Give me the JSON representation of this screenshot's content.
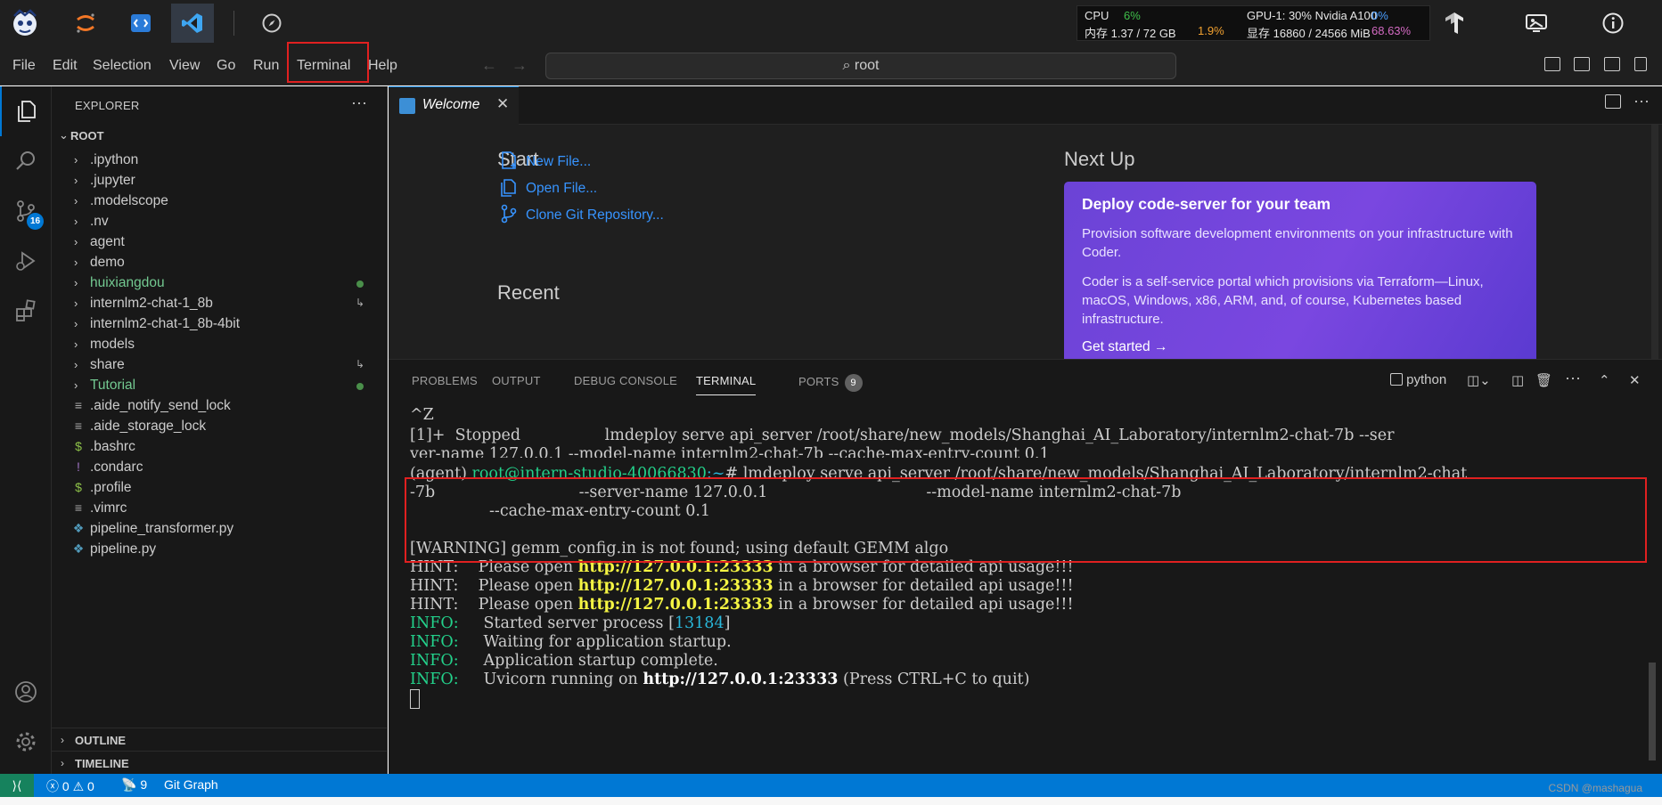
{
  "studio": {
    "stats": {
      "cpu_label": "CPU",
      "cpu_value": "6%",
      "mem_label": "内存 1.37 / 72 GB",
      "mem_value": "1.9%",
      "gpu_label": "GPU-1: 30% Nvidia A100",
      "gpu_value": "0%",
      "vram_label": "显存 16860 / 24566 MiB",
      "vram_value": "68.63%"
    }
  },
  "menubar": {
    "items": [
      "File",
      "Edit",
      "Selection",
      "View",
      "Go",
      "Run",
      "Terminal",
      "Help"
    ],
    "command_center": "root"
  },
  "activity": {
    "source_control_badge": "16"
  },
  "sidebar": {
    "title": "EXPLORER",
    "more": "···",
    "root": "ROOT",
    "items": [
      {
        "label": ".ipython",
        "type": "folder"
      },
      {
        "label": ".jupyter",
        "type": "folder"
      },
      {
        "label": ".modelscope",
        "type": "folder"
      },
      {
        "label": ".nv",
        "type": "folder"
      },
      {
        "label": "agent",
        "type": "folder"
      },
      {
        "label": "demo",
        "type": "folder"
      },
      {
        "label": "huixiangdou",
        "type": "folder"
      },
      {
        "label": "internlm2-chat-1_8b",
        "type": "folder"
      },
      {
        "label": "internlm2-chat-1_8b-4bit",
        "type": "folder"
      },
      {
        "label": "models",
        "type": "folder"
      },
      {
        "label": "share",
        "type": "folder"
      },
      {
        "label": "Tutorial",
        "type": "folder"
      },
      {
        "label": ".aide_notify_send_lock",
        "type": "file"
      },
      {
        "label": ".aide_storage_lock",
        "type": "file"
      },
      {
        "label": ".bashrc",
        "type": "file"
      },
      {
        "label": ".condarc",
        "type": "file"
      },
      {
        "label": ".profile",
        "type": "file"
      },
      {
        "label": ".vimrc",
        "type": "file"
      },
      {
        "label": "pipeline_transformer.py",
        "type": "file"
      },
      {
        "label": "pipeline.py",
        "type": "file"
      }
    ],
    "outline": "OUTLINE",
    "timeline": "TIMELINE"
  },
  "editor": {
    "tab_label": "Welcome",
    "start_heading": "Start",
    "new_file": "New File...",
    "open_file": "Open File...",
    "clone_repo": "Clone Git Repository...",
    "recent_heading": "Recent",
    "next_up_heading": "Next Up",
    "card": {
      "title": "Deploy code-server for your team",
      "p1": "Provision software development environments on your infrastructure with Coder.",
      "p2": "Coder is a self-service portal which provisions via Terraform—Linux, macOS, Windows, x86, ARM, and, of course, Kubernetes based infrastructure.",
      "link": "Get started →"
    }
  },
  "panel": {
    "tabs": [
      "PROBLEMS",
      "OUTPUT",
      "DEBUG CONSOLE",
      "TERMINAL",
      "PORTS"
    ],
    "ports_badge": "9",
    "shell": "python"
  },
  "terminal": {
    "l0": "^Z",
    "l1": "[1]+  Stopped                 lmdeploy serve api_server /root/share/new_models/Shanghai_AI_Laboratory/internlm2-chat-7b --ser",
    "l2": "ver-name 127.0.0.1 --model-name internlm2-chat-7b --cache-max-entry-count 0.1",
    "prompt_env": "(agent) ",
    "prompt_user": "root@intern-studio-40066830",
    "prompt_path": ":~",
    "cmd": "# lmdeploy serve api_server /root/share/new_models/Shanghai_AI_Laboratory/internlm2-chat",
    "cmd2": "-7b                             --server-name 127.0.0.1                                --model-name internlm2-chat-7b",
    "cmd3": "                --cache-max-entry-count 0.1",
    "warn": "[WARNING] gemm_config.in is not found; using default GEMM algo",
    "hint_pre": "HINT:    Please open ",
    "hint_url": "http://127.0.0.1:23333",
    "hint_post": " in a browser for detailed api usage!!!",
    "info_label": "INFO:",
    "info1_text": "     Started server process [",
    "info1_pid": "13184",
    "info1_end": "]",
    "info2_text": "     Waiting for application startup.",
    "info3_text": "     Application startup complete.",
    "info4_text": "     Uvicorn running on ",
    "info4_url": "http://127.0.0.1:23333",
    "info4_end": " (Press CTRL+C to quit)"
  },
  "statusbar": {
    "errors": "0",
    "warnings": "0",
    "ports": "9",
    "git_graph": "Git Graph"
  },
  "watermark": "CSDN @mashagua"
}
